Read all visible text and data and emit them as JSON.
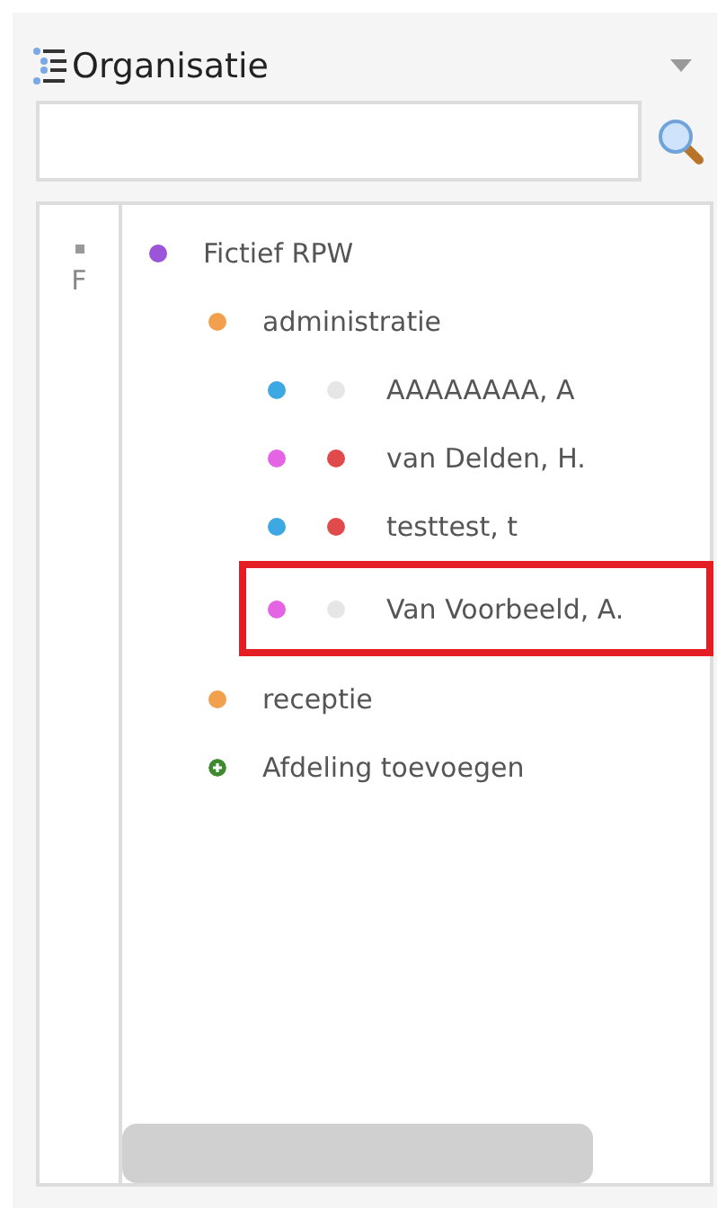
{
  "panel": {
    "title": "Organisatie"
  },
  "gutter": {
    "label": "F"
  },
  "tree": [
    {
      "label": "Fictief RPW",
      "kind": "node",
      "color": "#9b55d8",
      "highlighted": false,
      "children": [
        {
          "label": "administratie",
          "kind": "node",
          "color": "#f2a04e",
          "highlighted": false,
          "children": [
            {
              "label": "AAAAAAAA, A",
              "kind": "person",
              "color": "#3ea8e2",
              "status": {
                "color": "#e6e6e6"
              },
              "highlighted": false
            },
            {
              "label": "van Delden, H.",
              "kind": "person",
              "color": "#e464e4",
              "status": {
                "color": "#e04a4a"
              },
              "highlighted": false
            },
            {
              "label": "testtest, t",
              "kind": "person",
              "color": "#3ea8e2",
              "status": {
                "color": "#e04a4a"
              },
              "highlighted": false
            },
            {
              "label": "Van Voorbeeld, A.",
              "kind": "person",
              "color": "#e464e4",
              "status": {
                "color": "#e6e6e6"
              },
              "highlighted": true
            }
          ]
        },
        {
          "label": "receptie",
          "kind": "node",
          "color": "#f2a04e",
          "highlighted": false
        },
        {
          "label": "Afdeling toevoegen",
          "kind": "add",
          "color": "#3d8b2e",
          "highlighted": false
        }
      ]
    }
  ]
}
